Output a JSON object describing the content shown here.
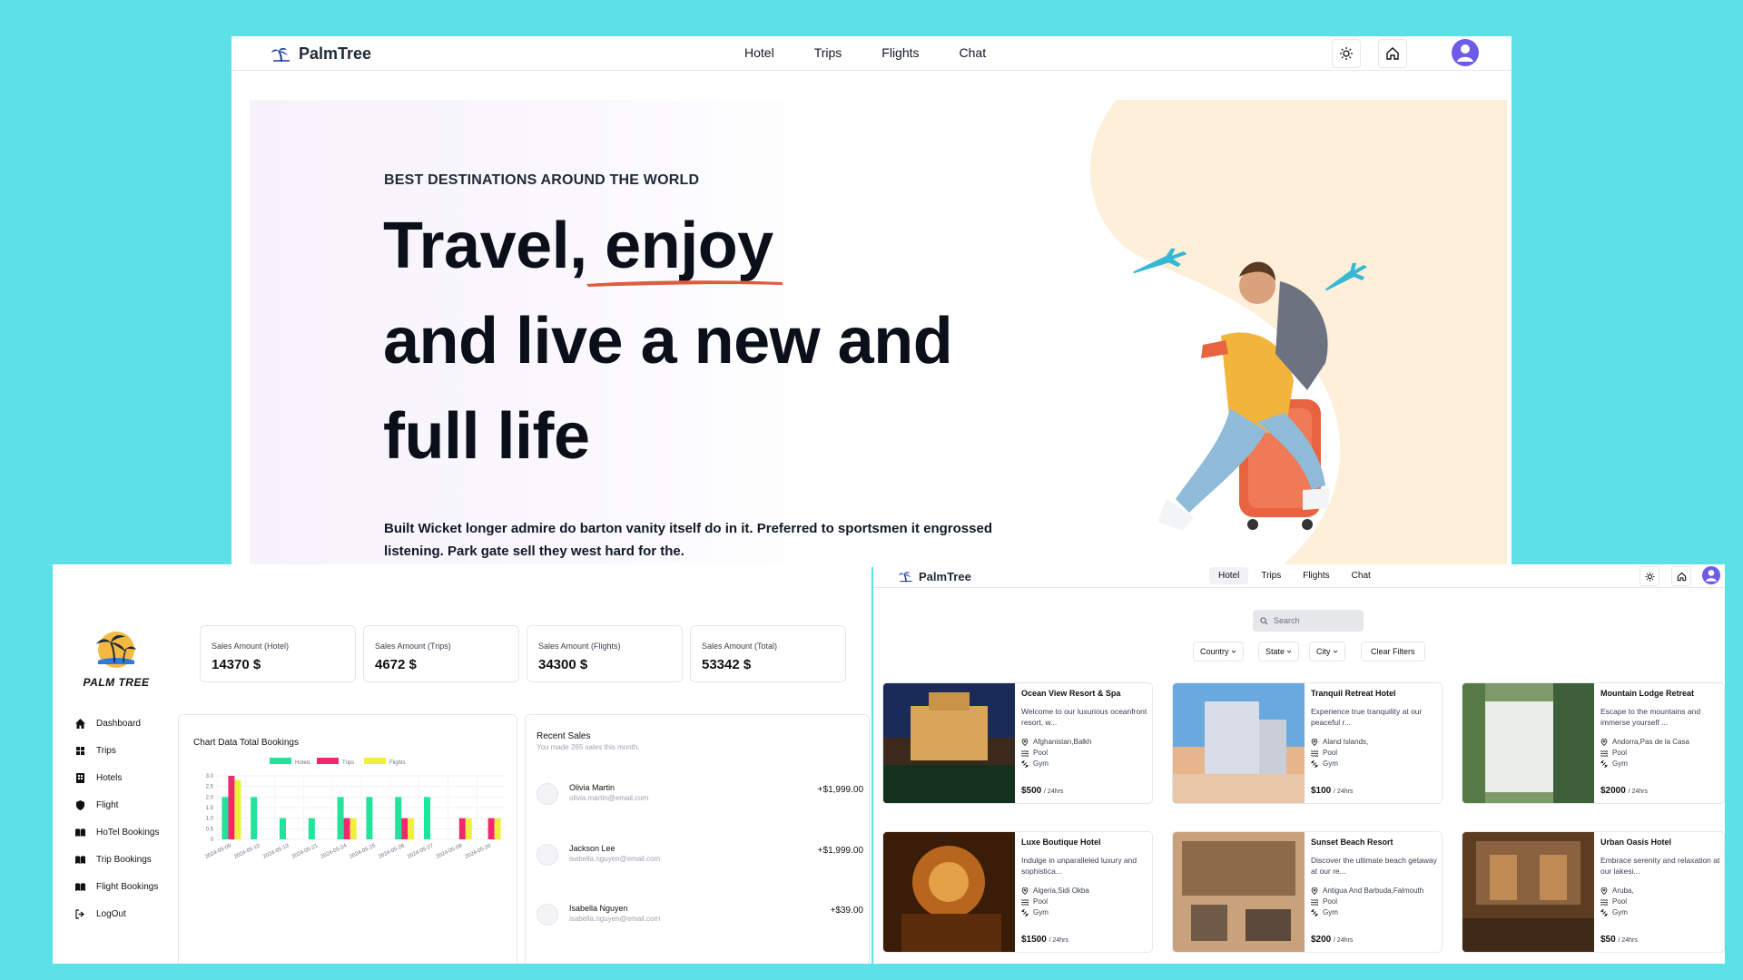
{
  "landing": {
    "brand": "PalmTree",
    "nav": [
      "Hotel",
      "Trips",
      "Flights",
      "Chat"
    ],
    "eyebrow": "BEST DESTINATIONS AROUND THE WORLD",
    "headline": {
      "line1a": "Travel, ",
      "line1b": "enjoy",
      "line2": "and live a new and",
      "line3": "full life"
    },
    "description": "Built Wicket longer admire do barton vanity itself do in it. Preferred to sportsmen it engrossed listening. Park gate sell they west hard for the.",
    "colors": {
      "peach": "#fdefd9",
      "underline": "#e05a3f",
      "avatar": "#6d5ce8"
    }
  },
  "dashboard": {
    "logo_text": "PALM TREE",
    "sidebar": [
      "Dashboard",
      "Trips",
      "Hotels",
      "Flight",
      "HoTel Bookings",
      "Trip Bookings",
      "Flight Bookings",
      "LogOut"
    ],
    "stats": [
      {
        "label": "Sales Amount (Hotel)",
        "value": "14370 $"
      },
      {
        "label": "Sales Amount (Trips)",
        "value": "4672 $"
      },
      {
        "label": "Sales Amount (Flights)",
        "value": "34300 $"
      },
      {
        "label": "Sales Amount (Total)",
        "value": "53342 $"
      }
    ],
    "chart_title": "Chart Data Total Bookings",
    "recent": {
      "title": "Recent Sales",
      "subtitle": "You made 265 sales this month.",
      "items": [
        {
          "name": "Olivia Martin",
          "email": "olivia.martin@email.com",
          "amount": "+$1,999.00"
        },
        {
          "name": "Jackson Lee",
          "email": "isabella.nguyen@email.com",
          "amount": "+$1,999.00"
        },
        {
          "name": "Isabella Nguyen",
          "email": "isabella.nguyen@email.com",
          "amount": "+$39.00"
        }
      ]
    }
  },
  "chart_data": {
    "type": "bar",
    "categories": [
      "2024-05-09",
      "2024-05-10",
      "2024-05-13",
      "2024-05-21",
      "2024-05-24",
      "2024-05-25",
      "2024-05-26",
      "2024-05-27",
      "2024-05-08",
      "2024-05-20"
    ],
    "series": [
      {
        "name": "Hotels",
        "color": "#22e39a",
        "values": [
          2,
          2,
          1,
          1,
          2,
          2,
          2,
          2,
          0,
          0
        ]
      },
      {
        "name": "Trips",
        "color": "#f0286e",
        "values": [
          3,
          0,
          0,
          0,
          1,
          0,
          1,
          0,
          1,
          1
        ]
      },
      {
        "name": "Flights",
        "color": "#eef03c",
        "values": [
          2.8,
          0,
          0,
          0,
          1,
          0,
          1,
          0,
          1,
          1
        ]
      }
    ],
    "yticks": [
      "3.0",
      "2.5",
      "2.0",
      "1.5",
      "1.0",
      "0.5",
      "0"
    ],
    "ylim": [
      0,
      3
    ],
    "legend": "top"
  },
  "hotels": {
    "brand": "PalmTree",
    "tabs": [
      "Hotel",
      "Trips",
      "Flights",
      "Chat"
    ],
    "search_placeholder": "Search",
    "filters": [
      "Country",
      "State",
      "City"
    ],
    "clear_filters": "Clear Filters",
    "cards": [
      {
        "title": "Ocean View Resort & Spa",
        "desc": "Welcome to our luxurious oceanfront resort, w...",
        "location": "Afghanistan,Balkh",
        "amenity1": "Pool",
        "amenity2": "Gym",
        "price": "$500",
        "unit": "/ 24hrs"
      },
      {
        "title": "Tranquil Retreat Hotel",
        "desc": "Experience true tranquility at our peaceful r...",
        "location": "Aland Islands,",
        "amenity1": "Pool",
        "amenity2": "Gym",
        "price": "$100",
        "unit": "/ 24hrs"
      },
      {
        "title": "Mountain Lodge Retreat",
        "desc": "Escape to the mountains and immerse yourself ...",
        "location": "Andorra,Pas de la Casa",
        "amenity1": "Pool",
        "amenity2": "Gym",
        "price": "$2000",
        "unit": "/ 24hrs"
      },
      {
        "title": "Luxe Boutique Hotel",
        "desc": "Indulge in unparalleled luxury and sophistica...",
        "location": "Algeria,Sidi Okba",
        "amenity1": "Pool",
        "amenity2": "Gym",
        "price": "$1500",
        "unit": "/ 24hrs"
      },
      {
        "title": "Sunset Beach Resort",
        "desc": "Discover the ultimate beach getaway at our re...",
        "location": "Antigua And Barbuda,Falmouth",
        "amenity1": "Pool",
        "amenity2": "Gym",
        "price": "$200",
        "unit": "/ 24hrs"
      },
      {
        "title": "Urban Oasis Hotel",
        "desc": "Embrace serenity and relaxation at our lakesi...",
        "location": "Aruba,",
        "amenity1": "Pool",
        "amenity2": "Gym",
        "price": "$50",
        "unit": "/ 24hrs"
      }
    ]
  }
}
